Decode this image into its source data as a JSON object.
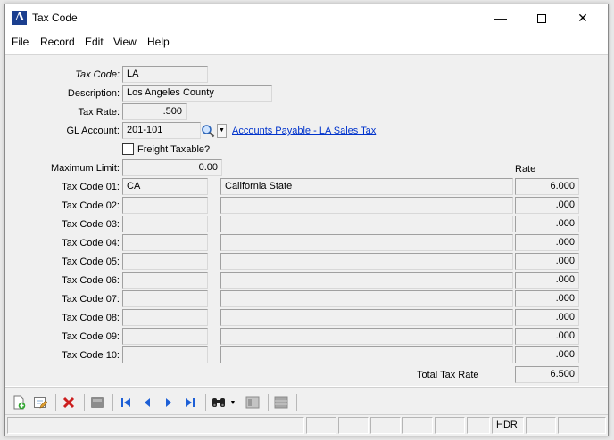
{
  "window": {
    "title": "Tax Code"
  },
  "menu": [
    "File",
    "Record",
    "Edit",
    "View",
    "Help"
  ],
  "form": {
    "tax_code_label": "Tax Code:",
    "tax_code": "LA",
    "description_label": "Description:",
    "description": "Los Angeles County",
    "tax_rate_label": "Tax Rate:",
    "tax_rate": ".500",
    "gl_account_label": "GL Account:",
    "gl_account": "201-101",
    "gl_account_link": "Accounts Payable - LA Sales Tax",
    "freight_label": "Freight Taxable?",
    "freight_checked": false,
    "max_limit_label": "Maximum Limit:",
    "max_limit": "0.00",
    "rate_header": "Rate",
    "tax_codes": [
      {
        "label": "Tax Code 01:",
        "code": "CA",
        "desc": "California State",
        "rate": "6.000"
      },
      {
        "label": "Tax Code 02:",
        "code": "",
        "desc": "",
        "rate": ".000"
      },
      {
        "label": "Tax Code 03:",
        "code": "",
        "desc": "",
        "rate": ".000"
      },
      {
        "label": "Tax Code 04:",
        "code": "",
        "desc": "",
        "rate": ".000"
      },
      {
        "label": "Tax Code 05:",
        "code": "",
        "desc": "",
        "rate": ".000"
      },
      {
        "label": "Tax Code 06:",
        "code": "",
        "desc": "",
        "rate": ".000"
      },
      {
        "label": "Tax Code 07:",
        "code": "",
        "desc": "",
        "rate": ".000"
      },
      {
        "label": "Tax Code 08:",
        "code": "",
        "desc": "",
        "rate": ".000"
      },
      {
        "label": "Tax Code 09:",
        "code": "",
        "desc": "",
        "rate": ".000"
      },
      {
        "label": "Tax Code 10:",
        "code": "",
        "desc": "",
        "rate": ".000"
      }
    ],
    "total_label": "Total Tax Rate",
    "total_rate": "6.500"
  },
  "toolbar": {
    "icons": [
      "new-record-icon",
      "edit-record-icon",
      "delete-icon",
      "save-icon",
      "first-record-icon",
      "previous-record-icon",
      "next-record-icon",
      "last-record-icon",
      "find-icon",
      "find-dropdown-icon",
      "list-icon",
      "grid-icon"
    ]
  },
  "status": {
    "mode": "HDR"
  },
  "colors": {
    "accent": "#1b3f8f",
    "link": "#0033cc",
    "delete": "#cc1f1f",
    "nav": "#1d5fd6"
  }
}
